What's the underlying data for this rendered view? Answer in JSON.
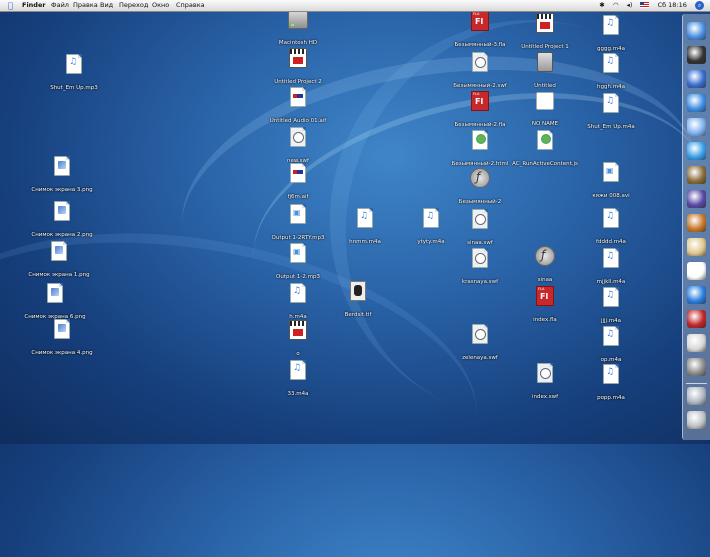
{
  "menubar": {
    "apple": "",
    "items": [
      "Finder",
      "Файл",
      "Правка",
      "Вид",
      "Переход",
      "Окно",
      "Справка"
    ],
    "clock": "Сб 18:16",
    "status_icons": [
      "bluetooth-icon",
      "wifi-icon",
      "volume-icon",
      "us-flag-icon",
      "spotlight-icon"
    ]
  },
  "desktop_icons": [
    {
      "label": "Shut_Em Up.mp3",
      "kind": "mp3"
    },
    {
      "label": "Снимок экрана 3.png",
      "kind": "png"
    },
    {
      "label": "Снимок экрана 2.png",
      "kind": "png"
    },
    {
      "label": "Снимок экрана 1.png",
      "kind": "png"
    },
    {
      "label": "Снимок экрана 6.png",
      "kind": "png"
    },
    {
      "label": "Снимок экрана 4.png",
      "kind": "png"
    },
    {
      "label": "Macintosh HD",
      "kind": "hd"
    },
    {
      "label": "Untitled Project 2",
      "kind": "proj"
    },
    {
      "label": "Untitled Audio 01.aif",
      "kind": "aif"
    },
    {
      "label": "new.swf",
      "kind": "swf"
    },
    {
      "label": "fj6m.aif",
      "kind": "aif"
    },
    {
      "label": "Output 1-2RTY.mp3",
      "kind": "m4v"
    },
    {
      "label": "Output 1-2.mp3",
      "kind": "m4v"
    },
    {
      "label": "h.m4a",
      "kind": "mp3"
    },
    {
      "label": "o",
      "kind": "proj"
    },
    {
      "label": "33.m4a",
      "kind": "mp3"
    },
    {
      "label": "hnmm.m4a",
      "kind": "mp3"
    },
    {
      "label": "Berdsit.tif",
      "kind": "tif"
    },
    {
      "label": "ytyty.m4a",
      "kind": "mp3"
    },
    {
      "label": "Безымянный-3.fla",
      "kind": "fla"
    },
    {
      "label": "Безымянный-2.swf",
      "kind": "swf"
    },
    {
      "label": "Безымянный-2.fla",
      "kind": "fla"
    },
    {
      "label": "Безымянный-2.html",
      "kind": "html"
    },
    {
      "label": "Безымянный-2",
      "kind": "flash"
    },
    {
      "label": "sinaa.swf",
      "kind": "swf"
    },
    {
      "label": "krasnaya.swf",
      "kind": "swf"
    },
    {
      "label": "zelenaya.swf",
      "kind": "swf"
    },
    {
      "label": "Untitled Project 1",
      "kind": "proj"
    },
    {
      "label": "Untitled",
      "kind": "drive"
    },
    {
      "label": "NO NAME",
      "kind": "disk"
    },
    {
      "label": "AC_RunActiveContent.js",
      "kind": "html"
    },
    {
      "label": "sinaa",
      "kind": "flash"
    },
    {
      "label": "index.fla",
      "kind": "fla"
    },
    {
      "label": "index.swf",
      "kind": "swf"
    },
    {
      "label": "gggg.m4a",
      "kind": "mp3"
    },
    {
      "label": "hggh.m4a",
      "kind": "mp3"
    },
    {
      "label": "Shut_Em Up.m4a",
      "kind": "mp3"
    },
    {
      "label": "кяжи 008.avi",
      "kind": "m4v"
    },
    {
      "label": "fdddd.m4a",
      "kind": "mp3"
    },
    {
      "label": "mjjkll.m4a",
      "kind": "mp3"
    },
    {
      "label": "jjjj.m4a",
      "kind": "mp3"
    },
    {
      "label": "op.m4a",
      "kind": "mp3"
    },
    {
      "label": "popp.m4a",
      "kind": "mp3"
    }
  ],
  "dock": {
    "items": [
      "finder-icon",
      "dashboard-icon",
      "mail-icon",
      "safari-icon",
      "ichat-icon",
      "itunes-icon",
      "iphoto-icon",
      "imovie-icon",
      "garageband-icon",
      "address-book-icon",
      "ical-icon",
      "quicktime-icon",
      "flash-icon",
      "preview-icon",
      "system-preferences-icon",
      "downloads-icon",
      "trash-icon"
    ],
    "colors": [
      "#4a8fe0",
      "#333333",
      "#3b6fd0",
      "#3d8ee6",
      "#7fb2f0",
      "#3aa0e8",
      "#8b6d3a",
      "#5a4aa8",
      "#c8782a",
      "#e0c890",
      "#ffffff",
      "#2a7fe0",
      "#c0282a",
      "#d8d8d8",
      "#8c8c8c",
      "#b0b8c4",
      "#c0c4c8"
    ]
  }
}
